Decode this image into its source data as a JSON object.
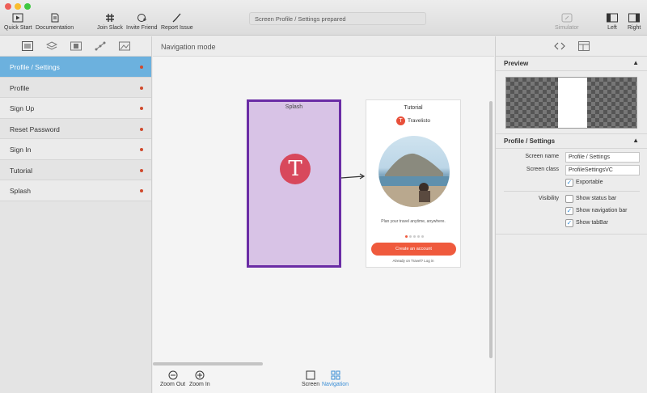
{
  "toolbar": {
    "traffic_colors": [
      "#ee5f58",
      "#f9bd2e",
      "#3fc842"
    ],
    "quick_start": "Quick Start",
    "documentation": "Documentation",
    "join_slack": "Join Slack",
    "invite_friend": "Invite Friend",
    "report_issue": "Report Issue",
    "status": "Screen Profile / Settings prepared",
    "simulator": "Simulator",
    "left": "Left",
    "right": "Right"
  },
  "sidebar": {
    "items": [
      {
        "label": "Profile / Settings",
        "selected": true
      },
      {
        "label": "Profile"
      },
      {
        "label": "Sign Up"
      },
      {
        "label": "Reset Password"
      },
      {
        "label": "Sign In"
      },
      {
        "label": "Tutorial"
      },
      {
        "label": "Splash"
      }
    ]
  },
  "canvas": {
    "mode_title": "Navigation mode",
    "splash_label": "Splash",
    "splash_logo_letter": "T",
    "tutorial": {
      "title": "Tutorial",
      "brand_letter": "T",
      "brand": "Travelisto",
      "tagline": "Plan your travel anytime, anywhere.",
      "cta": "Create an account",
      "login": "Already on Travel? Log in"
    },
    "zoom_out": "Zoom Out",
    "zoom_in": "Zoom In",
    "screen": "Screen",
    "navigation": "Navigation"
  },
  "inspector": {
    "preview_title": "Preview",
    "section_title": "Profile / Settings",
    "screen_name_label": "Screen name",
    "screen_name": "Profile / Settings",
    "screen_class_label": "Screen class",
    "screen_class": "ProfileSettingsVC",
    "exportable": "Exportable",
    "visibility_label": "Visibility",
    "show_status_bar": "Show status bar",
    "show_navigation_bar": "Show navigation bar",
    "show_tabbar": "Show tabBar"
  }
}
